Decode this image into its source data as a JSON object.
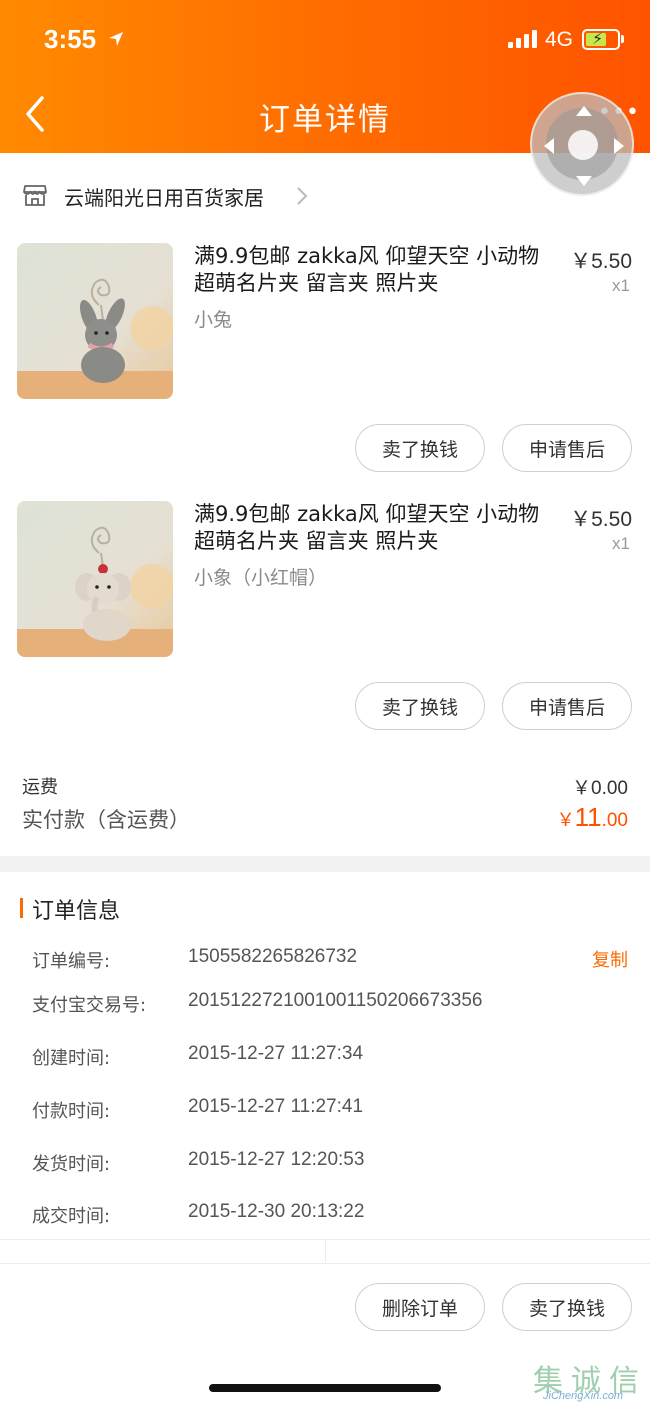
{
  "status_bar": {
    "time": "3:55",
    "network": "4G"
  },
  "header": {
    "title": "订单详情"
  },
  "shop": {
    "name": "云端阳光日用百货家居"
  },
  "items": [
    {
      "title": "满9.9包邮 zakka风 仰望天空 小动物超萌名片夹 留言夹 照片夹",
      "sku": "小兔",
      "price": "￥5.50",
      "qty": "x1",
      "actions": [
        "卖了换钱",
        "申请售后"
      ]
    },
    {
      "title": "满9.9包邮 zakka风 仰望天空 小动物超萌名片夹 留言夹 照片夹",
      "sku": "小象（小红帽）",
      "price": "￥5.50",
      "qty": "x1",
      "actions": [
        "卖了换钱",
        "申请售后"
      ]
    }
  ],
  "fees": {
    "shipping_label": "运费",
    "shipping_value": "￥0.00",
    "paid_label": "实付款（含运费）",
    "paid_currency": "￥",
    "paid_int": "11",
    "paid_dec": ".00"
  },
  "order_info": {
    "title": "订单信息",
    "copy_label": "复制",
    "rows": [
      {
        "label": "订单编号:",
        "value": "1505582265826732"
      },
      {
        "label": "支付宝交易号:",
        "value": "2015122721001001150206673356"
      },
      {
        "label": "创建时间:",
        "value": "2015-12-27 11:27:34"
      },
      {
        "label": "付款时间:",
        "value": "2015-12-27 11:27:41"
      },
      {
        "label": "发货时间:",
        "value": "2015-12-27 12:20:53"
      },
      {
        "label": "成交时间:",
        "value": "2015-12-30 20:13:22"
      }
    ]
  },
  "bottom_actions": [
    "删除订单",
    "卖了换钱"
  ],
  "watermark": {
    "chars": [
      "集",
      "诚",
      "信"
    ],
    "url": "JiChengXin.com"
  },
  "colors": {
    "accent": "#ff6a00",
    "price": "#ff5000"
  }
}
